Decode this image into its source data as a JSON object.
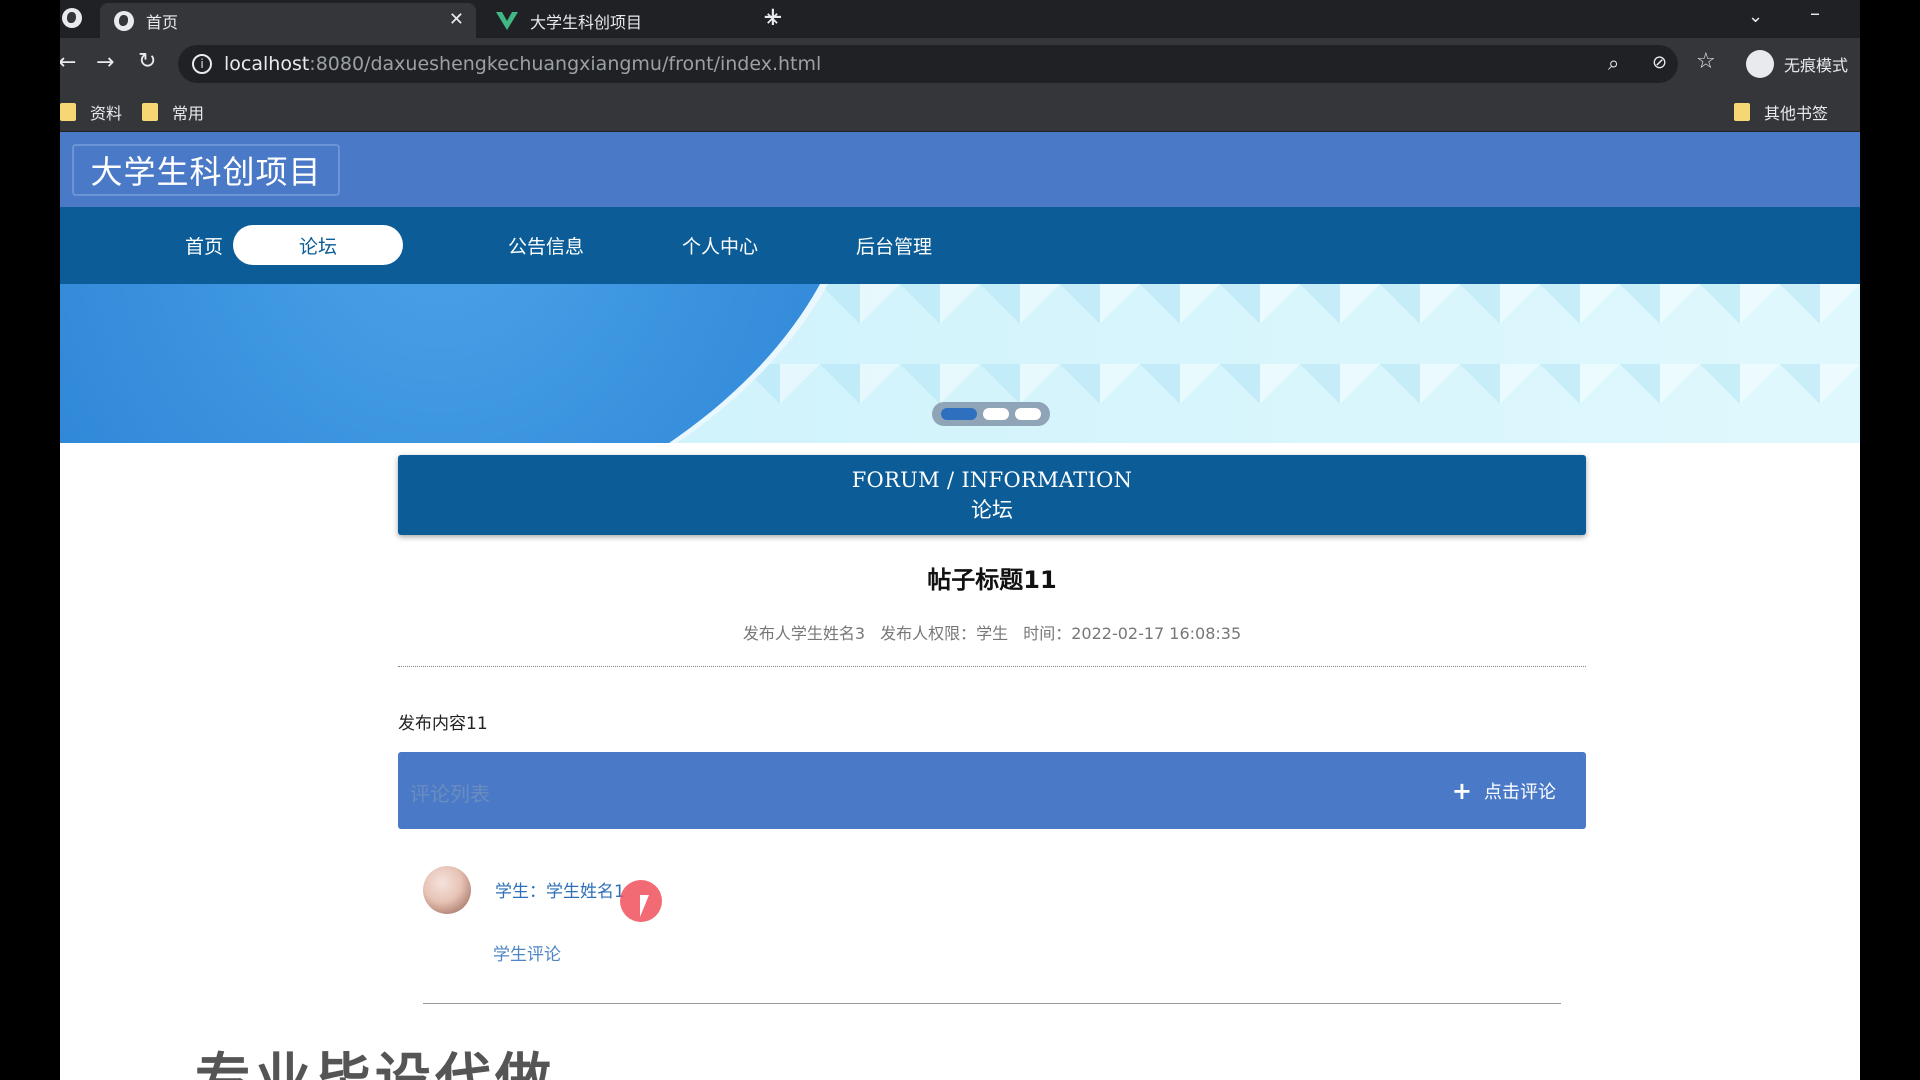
{
  "browser": {
    "tabs": [
      {
        "title": "首页",
        "active": true
      },
      {
        "title": "大学生科创项目",
        "active": false
      }
    ],
    "address": {
      "host": "localhost",
      "rest": ":8080/daxueshengkechuangxiangmu/front/index.html"
    },
    "incognito_label": "无痕模式",
    "bookmarks": [
      "资料",
      "常用"
    ],
    "other_bookmarks": "其他书签"
  },
  "site": {
    "logo": "大学生科创项目",
    "nav": [
      {
        "label": "首页",
        "active": false
      },
      {
        "label": "论坛",
        "active": true
      },
      {
        "label": "公告信息",
        "active": false
      },
      {
        "label": "个人中心",
        "active": false
      },
      {
        "label": "后台管理",
        "active": false
      }
    ],
    "carousel": {
      "slides": 3,
      "active": 0
    }
  },
  "section": {
    "title_en": "FORUM / INFORMATION",
    "title_cn": "论坛"
  },
  "post": {
    "title": "帖子标题11",
    "author": "发布人学生姓名3",
    "role": "发布人权限：学生",
    "time": "时间：2022-02-17 16:08:35",
    "content": "发布内容11"
  },
  "comments": {
    "header": "评论列表",
    "add_label": "点击评论",
    "items": [
      {
        "author": "学生：学生姓名1",
        "text": "学生评论"
      }
    ]
  },
  "watermark": "专业毕设代做",
  "colors": {
    "header": "#4a7ac7",
    "nav": "#0b5c97",
    "accent": "#2d6fb8"
  }
}
